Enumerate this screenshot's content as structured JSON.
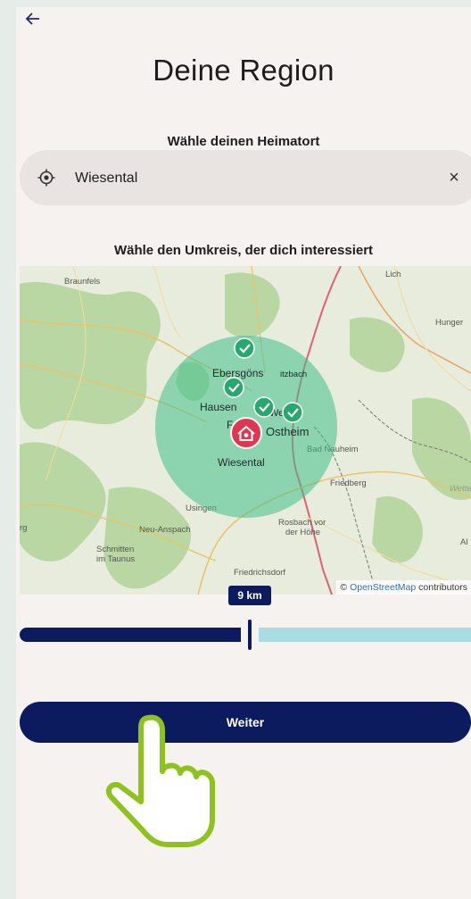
{
  "header": {
    "back_icon": "arrow-left-icon",
    "title": "Deine Region"
  },
  "hometown": {
    "label": "Wähle deinen Heimatort",
    "value": "Wiesental",
    "location_icon": "location-target-icon",
    "clear_icon": "close-icon",
    "clear_glyph": "×"
  },
  "radius": {
    "label": "Wähle den Umkreis, der dich interessiert",
    "value_label": "9 km",
    "fraction": 0.51
  },
  "map": {
    "attribution_prefix": "© ",
    "attribution_link": "OpenStreetMap",
    "attribution_suffix": " contributors",
    "places": {
      "braunfels": "Braunfels",
      "lich": "Lich",
      "hungen": "Hunger",
      "ebersgoens": "Ebersgöns",
      "butzbach": "itzbach",
      "hausen": "Hausen",
      "oberkleen": "Fa",
      "weisel": "Weisel",
      "ostheim": "Ostheim",
      "wiesental": "Wiesental",
      "bad_nauheim": "Bad Nauheim",
      "friedberg": "Friedberg",
      "usingen": "Usingen",
      "neu_anspach": "Neu-Anspach",
      "schmitten_1": "Schmitten",
      "schmitten_2": "im Taunus",
      "rosbach_1": "Rosbach vor",
      "rosbach_2": "der Höhe",
      "friedrichsdorf": "Friedrichsdorf",
      "wetterau": "Wette",
      "weilrod": "rg",
      "altenstadt": "Al"
    },
    "colors": {
      "radius_circle": "#3fbf8c",
      "check_marker": "#27a86f",
      "home_marker": "#e0364f"
    }
  },
  "actions": {
    "continue_label": "Weiter"
  },
  "colors": {
    "primary": "#0c1b5e",
    "slider_rest": "#a7dde3",
    "pointer": "#8dc21f"
  }
}
